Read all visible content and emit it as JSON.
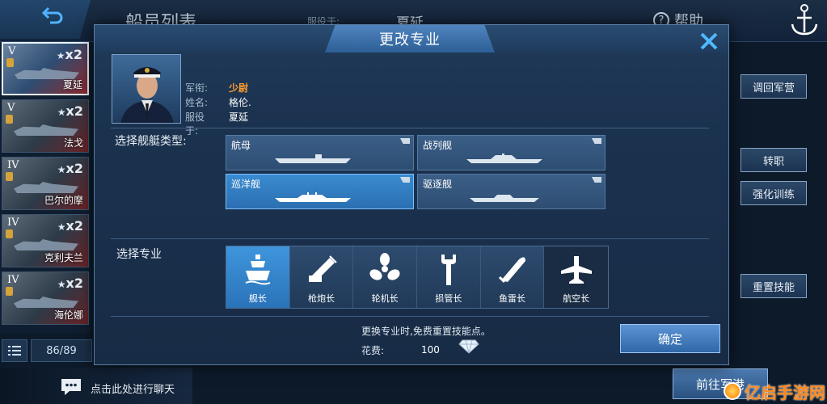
{
  "background": {
    "title": "船员列表",
    "served_label": "服役于:",
    "ship_name": "夏延",
    "help_label": "帮助",
    "crew_count": "86/89",
    "chat_text": "点击此处进行聊天",
    "go_port_label": "前往军港",
    "side_buttons": [
      "调回军营",
      "转职",
      "强化训练",
      "重置技能"
    ],
    "watermark_text": "亿启手游网"
  },
  "crew_list": [
    {
      "rank": "V",
      "multiplier": "x2",
      "name": "夏延",
      "selected": true
    },
    {
      "rank": "V",
      "multiplier": "x2",
      "name": "法戈",
      "selected": false
    },
    {
      "rank": "IV",
      "multiplier": "x2",
      "name": "巴尔的摩",
      "selected": false
    },
    {
      "rank": "IV",
      "multiplier": "x2",
      "name": "克利夫兰",
      "selected": false
    },
    {
      "rank": "IV",
      "multiplier": "x2",
      "name": "海伦娜",
      "selected": false
    }
  ],
  "dialog": {
    "title": "更改专业",
    "officer": {
      "rank_label": "军衔:",
      "rank_value": "少尉",
      "name_label": "姓名:",
      "name_value": "格伦.",
      "served_label": "服役于:",
      "served_value": "夏延"
    },
    "ship_type_label": "选择舰艇类型:",
    "ship_types": [
      {
        "label": "航母",
        "selected": false
      },
      {
        "label": "战列舰",
        "selected": false
      },
      {
        "label": "巡洋舰",
        "selected": true
      },
      {
        "label": "驱逐舰",
        "selected": false
      }
    ],
    "profession_label": "选择专业",
    "professions": [
      {
        "label": "舰长",
        "icon": "ship-captain-icon",
        "selected": true
      },
      {
        "label": "枪炮长",
        "icon": "cannon-icon",
        "selected": false
      },
      {
        "label": "轮机长",
        "icon": "propeller-icon",
        "selected": false
      },
      {
        "label": "损管长",
        "icon": "wrench-icon",
        "selected": false
      },
      {
        "label": "鱼雷长",
        "icon": "torpedo-icon",
        "selected": false
      },
      {
        "label": "航空长",
        "icon": "airplane-icon",
        "selected": false
      }
    ],
    "free_note": "更换专业时,免费重置技能点。",
    "cost_label": "花费:",
    "cost_value": "100",
    "confirm_label": "确定"
  },
  "colors": {
    "accent": "#2b6fb2",
    "rank_highlight": "#ff9a2e",
    "dialog_bg": "#1b324f"
  }
}
